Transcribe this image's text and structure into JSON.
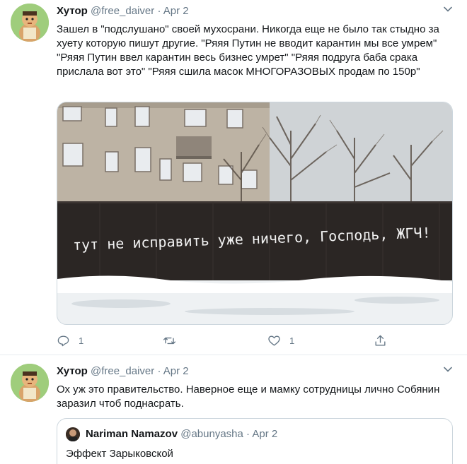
{
  "tweets": [
    {
      "author_name": "Хутор",
      "handle": "@free_daiver",
      "separator": "·",
      "date": "Apr 2",
      "text": "Зашел в \"подслушано\" своей мухосрани. Никогда еще не было так стыдно за хуету которую пишут другие. \"Ряяя Путин не вводит карантин мы все умрем\" \"Ряяя Путин ввел карантин весь бизнес умрет\" \"Ряяя подруга баба срака прислала вот это\" \"Ряяя сшила масок МНОГОРАЗОВЫХ продам по 150р\"",
      "image_graffiti": "тут не исправить уже ничего, Господь, ЖГЧ!",
      "reply_count": "1",
      "retweet_count": "",
      "like_count": "1"
    },
    {
      "author_name": "Хутор",
      "handle": "@free_daiver",
      "separator": "·",
      "date": "Apr 2",
      "text": "Ох уж это правительство. Наверное еще и мамку сотрудницы лично Собянин заразил чтоб поднасрать.",
      "quoted": {
        "author_name": "Nariman Namazov",
        "handle": "@abunyasha",
        "separator": "·",
        "date": "Apr 2",
        "text": "Эффект Зарыковской"
      }
    }
  ],
  "icons": {
    "reply": "reply-icon",
    "retweet": "retweet-icon",
    "like": "heart-icon",
    "share": "share-icon",
    "caret": "chevron-down-icon"
  },
  "colors": {
    "text_primary": "#14171a",
    "text_secondary": "#657786",
    "border": "#e6ecf0",
    "avatar_bg": "#9fcd7c"
  }
}
